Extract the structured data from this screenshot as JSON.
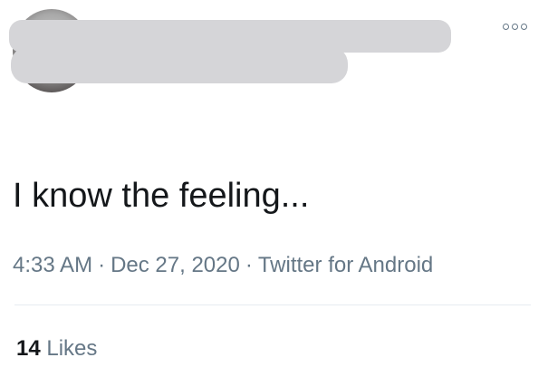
{
  "tweet": {
    "text": "I know the feeling...",
    "time": "4:33 AM",
    "date": "Dec 27, 2020",
    "separator": "·",
    "source": "Twitter for Android",
    "likes_count": "14",
    "likes_label": "Likes"
  },
  "icons": {
    "more": "more-options-icon"
  },
  "colors": {
    "text_primary": "#14171a",
    "text_secondary": "#657786",
    "divider": "#e6ecf0",
    "redaction": "#d5d5d8"
  }
}
